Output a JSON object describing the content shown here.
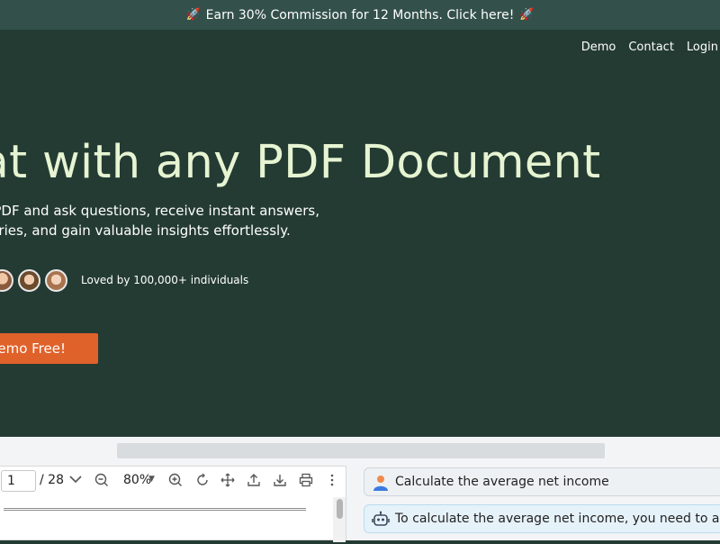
{
  "banner": {
    "text": "Earn 30% Commission for 12 Months. Click here!",
    "icon": "rocket-icon"
  },
  "nav": {
    "items": [
      "Demo",
      "Contact",
      "Login"
    ]
  },
  "hero": {
    "headline": "hat with any PDF Document",
    "subtitle_line1": "any PDF and ask questions, receive instant answers,",
    "subtitle_line2": "mmaries, and gain valuable insights effortlessly.",
    "loved_text": "Loved by 100,000+ individuals",
    "cta_label": "Demo Free!"
  },
  "viewer": {
    "page_value": "1",
    "page_total": "/ 28",
    "zoom": "80%"
  },
  "chat": {
    "user_message": "Calculate the average net income",
    "bot_message": "To calculate the average net income, you need to add th"
  },
  "colors": {
    "banner_bg": "#33514a",
    "hero_bg": "#243b33",
    "headline": "#e6f4d2",
    "cta": "#e0622b"
  }
}
